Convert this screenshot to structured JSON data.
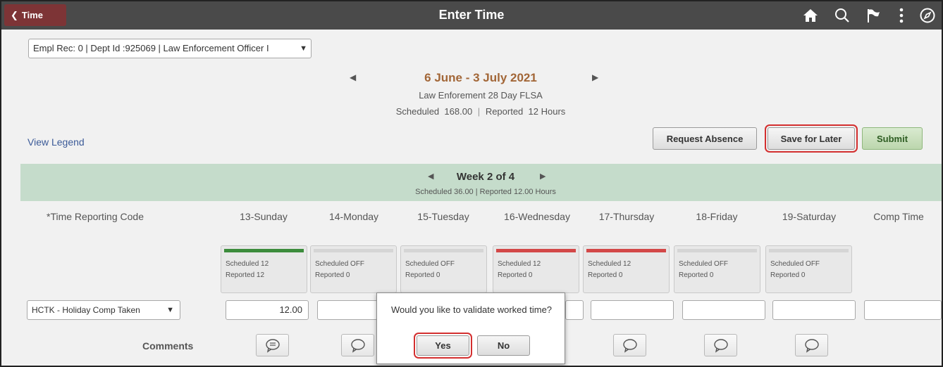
{
  "header": {
    "back_label": "Time",
    "title": "Enter Time",
    "icons": [
      "home-icon",
      "search-icon",
      "flag-icon",
      "more-vertical-icon",
      "compass-icon"
    ]
  },
  "employee_record": {
    "selected": "Empl Rec: 0 | Dept Id :925069 | Law Enforcement Officer I"
  },
  "period": {
    "range": "6 June - 3 July 2021",
    "schedule_name": "Law Enforement 28 Day FLSA",
    "scheduled_label": "Scheduled",
    "scheduled_value": "168.00",
    "reported_label": "Reported",
    "reported_value": "12 Hours"
  },
  "actions": {
    "view_legend": "View Legend",
    "request_absence": "Request Absence",
    "save_for_later": "Save for Later",
    "submit": "Submit"
  },
  "week": {
    "title": "Week 2 of 4",
    "summary": "Scheduled  36.00 | Reported  12.00 Hours"
  },
  "grid": {
    "trc_header": "*Time Reporting Code",
    "days": [
      {
        "label": "13-Sunday",
        "scheduled": "Scheduled 12",
        "reported": "Reported  12",
        "status_color": "#3c8c3c",
        "hours": "12.00"
      },
      {
        "label": "14-Monday",
        "scheduled": "Scheduled OFF",
        "reported": "Reported  0",
        "status_color": "#d5d5d5",
        "hours": ""
      },
      {
        "label": "15-Tuesday",
        "scheduled": "Scheduled OFF",
        "reported": "Reported  0",
        "status_color": "#d5d5d5",
        "hours": ""
      },
      {
        "label": "16-Wednesday",
        "scheduled": "Scheduled 12",
        "reported": "Reported  0",
        "status_color": "#d34848",
        "hours": ""
      },
      {
        "label": "17-Thursday",
        "scheduled": "Scheduled 12",
        "reported": "Reported  0",
        "status_color": "#d34848",
        "hours": ""
      },
      {
        "label": "18-Friday",
        "scheduled": "Scheduled OFF",
        "reported": "Reported  0",
        "status_color": "#d5d5d5",
        "hours": ""
      },
      {
        "label": "19-Saturday",
        "scheduled": "Scheduled OFF",
        "reported": "Reported  0",
        "status_color": "#d5d5d5",
        "hours": ""
      }
    ],
    "comp_time_header": "Comp Time",
    "trc_value": "HCTK - Holiday Comp Taken",
    "comments_label": "Comments"
  },
  "dialog": {
    "message": "Would you like to validate worked time?",
    "yes": "Yes",
    "no": "No"
  },
  "colors": {
    "header_bg": "#4a4a4a",
    "back_button_bg": "#7d3436",
    "period_title": "#a26637",
    "week_band": "#c5dccb",
    "highlight": "#d32f2f"
  }
}
